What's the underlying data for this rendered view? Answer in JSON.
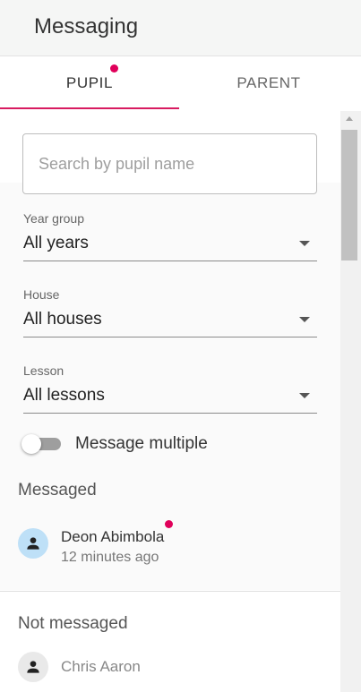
{
  "header": {
    "title": "Messaging"
  },
  "tabs": [
    {
      "label": "PUPIL",
      "active": true,
      "has_notification": true
    },
    {
      "label": "PARENT",
      "active": false,
      "has_notification": false
    }
  ],
  "search": {
    "placeholder": "Search by pupil name",
    "value": ""
  },
  "filters": {
    "year_group": {
      "label": "Year group",
      "value": "All years"
    },
    "house": {
      "label": "House",
      "value": "All houses"
    },
    "lesson": {
      "label": "Lesson",
      "value": "All lessons"
    }
  },
  "toggle": {
    "label": "Message multiple",
    "on": false
  },
  "messaged": {
    "title": "Messaged",
    "items": [
      {
        "name": "Deon Abimbola",
        "time": "12 minutes ago",
        "unread": true,
        "icon": "person-icon"
      }
    ]
  },
  "not_messaged": {
    "title": "Not messaged",
    "items": [
      {
        "name": "Chris Aaron",
        "icon": "person-icon"
      }
    ]
  },
  "colors": {
    "accent": "#d81b60",
    "notification_dot": "#e0005a",
    "avatar_active": "#bee0f7",
    "avatar_default": "#e9e9e9"
  }
}
